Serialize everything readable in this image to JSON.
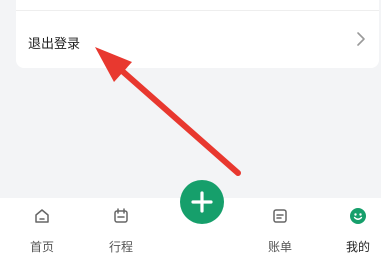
{
  "settings": {
    "logout_label": "退出登录"
  },
  "tabbar": {
    "tabs": [
      {
        "label": "首页",
        "icon": "home-icon"
      },
      {
        "label": "行程",
        "icon": "calendar-icon"
      },
      {
        "label": "账单",
        "icon": "bill-icon"
      },
      {
        "label": "我的",
        "icon": "profile-icon",
        "active": true
      }
    ],
    "fab_icon": "plus-icon"
  },
  "colors": {
    "accent_green": "#169f6b",
    "annotation_arrow": "#e8382f",
    "background": "#f3f4f6"
  }
}
